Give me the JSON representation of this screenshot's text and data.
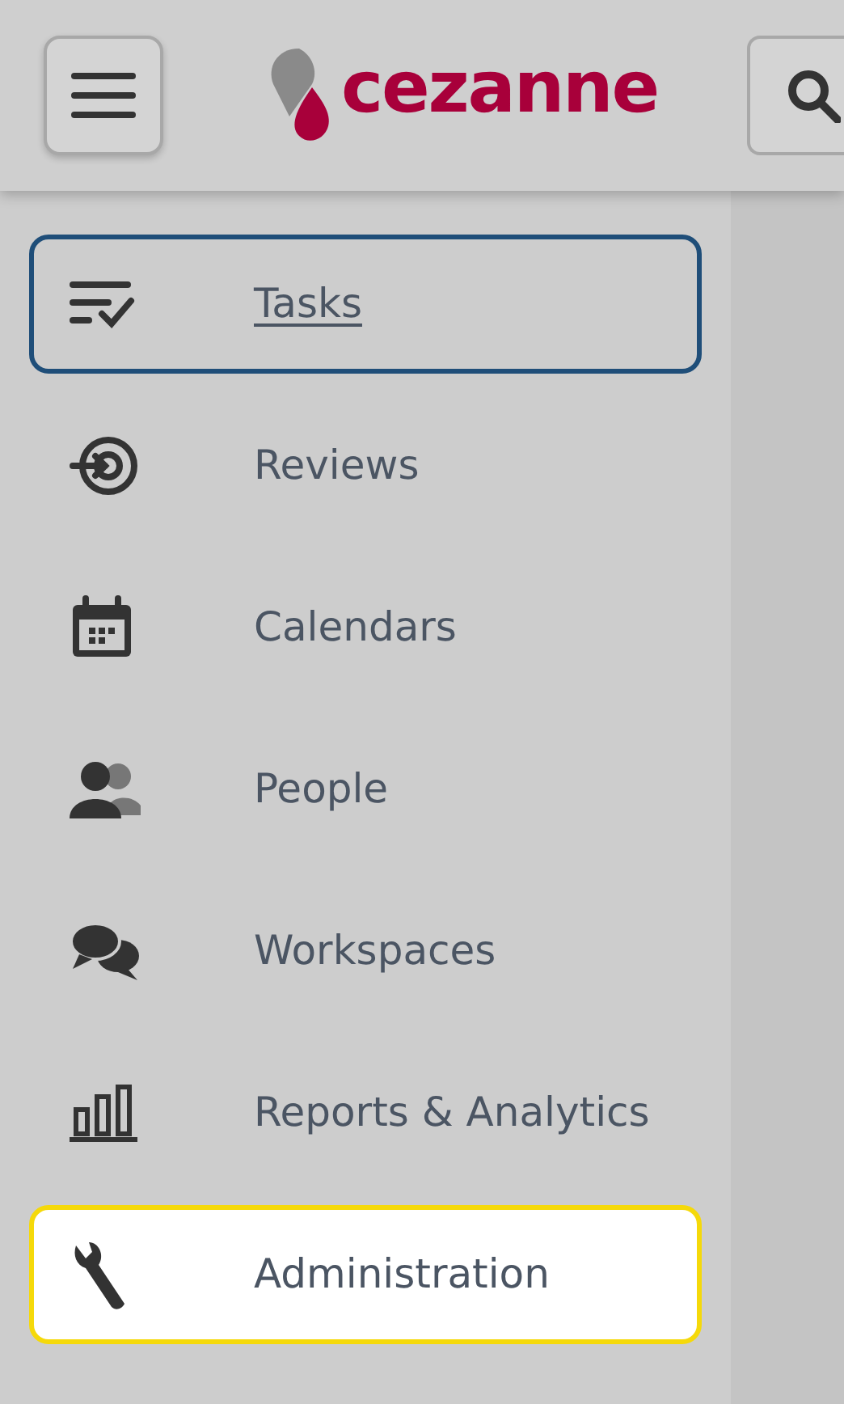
{
  "header": {
    "brand": "cezanne"
  },
  "nav_items": [
    {
      "label": "Tasks",
      "kind": "tasks",
      "focused": true,
      "highlighted": false
    },
    {
      "label": "Reviews",
      "kind": "reviews",
      "focused": false,
      "highlighted": false
    },
    {
      "label": "Calendars",
      "kind": "calendar",
      "focused": false,
      "highlighted": false
    },
    {
      "label": "People",
      "kind": "people",
      "focused": false,
      "highlighted": false
    },
    {
      "label": "Workspaces",
      "kind": "chat",
      "focused": false,
      "highlighted": false
    },
    {
      "label": "Reports & Analytics",
      "kind": "chart",
      "focused": false,
      "highlighted": false
    },
    {
      "label": "Administration",
      "kind": "wrench",
      "focused": false,
      "highlighted": true
    }
  ]
}
